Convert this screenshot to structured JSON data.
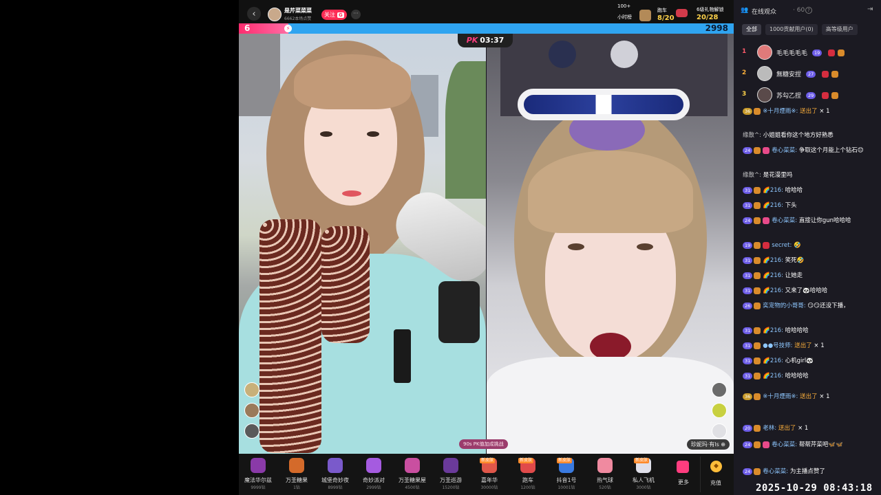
{
  "header": {
    "host_name": "是芹菜菜菜",
    "host_sub": "6662本场点赞",
    "follow_label": "关注",
    "follow_badge": "G",
    "stat1_top": "100+",
    "stat1_label": "小时榜",
    "stat2_label": "跑车",
    "stat2_value": "8/20",
    "stat3_label": "6级礼物解锁",
    "stat3_value": "20/28"
  },
  "pk": {
    "left_score": "6",
    "right_score": "2998",
    "timer_tag": "PK",
    "timer": "03:37",
    "challenge": "90s PK值加成挑战",
    "opponent": "珍妮玛·有ls"
  },
  "gifts": [
    {
      "name": "魔法华尔兹",
      "price": "9999钻",
      "color": "#8a3aa8"
    },
    {
      "name": "万圣糖果",
      "price": "1钻",
      "color": "#d46a2a"
    },
    {
      "name": "城堡奇妙夜",
      "price": "8999钻",
      "color": "#7a5acb"
    },
    {
      "name": "奇妙派对",
      "price": "2999钻",
      "color": "#a55be0"
    },
    {
      "name": "万圣糖果屋",
      "price": "4500钻",
      "color": "#c94fa0"
    },
    {
      "name": "万圣巡游",
      "price": "15200钻",
      "color": "#6a3a9a"
    },
    {
      "name": "嘉年华",
      "price": "30000钻",
      "color": "#e0574a",
      "tag": "新皮肤"
    },
    {
      "name": "跑车",
      "price": "1200钻",
      "color": "#e04a4a",
      "tag": "新皮肤"
    },
    {
      "name": "抖音1号",
      "price": "10001钻",
      "color": "#3a7ae0",
      "tag": "新皮肤"
    },
    {
      "name": "热气球",
      "price": "520钻",
      "color": "#f08aa0"
    },
    {
      "name": "私人飞机",
      "price": "3000钻",
      "color": "#e0e0ea",
      "tag": "新皮肤"
    }
  ],
  "gift_more": "更多",
  "recharge": "充值",
  "panel": {
    "title": "在线观众",
    "count": "· 60",
    "tabs": [
      "全部",
      "1000贡献用户(0)",
      "高等级用户"
    ],
    "ranks": [
      {
        "no": "1",
        "name": "毛毛毛毛毛",
        "level": "19",
        "color": "#e07a7a"
      },
      {
        "no": "2",
        "name": "無糖安捏",
        "level": "27",
        "color": "#bbbbbb"
      },
      {
        "no": "3",
        "name": "苏勾乙捏",
        "level": "29",
        "color": "#5a4a4a"
      }
    ]
  },
  "chat": [
    {
      "lvl": "36",
      "gold": true,
      "user": "※十月煙雨※:",
      "text": "送出了",
      "sent": true,
      "x": "× 1"
    },
    {
      "user": "缘散^:",
      "text": "小姐姐看你这个地方好熟悉"
    },
    {
      "lvl": "24",
      "fan": "pink",
      "user": "卷心菜菜:",
      "text": "争取这个月能上个钻石😊"
    },
    {
      "user": "缘散^:",
      "text": "是花漫里吗"
    },
    {
      "lvl": "31",
      "user": "🌈216:",
      "text": "哈哈哈"
    },
    {
      "lvl": "31",
      "user": "🌈216:",
      "text": "下头"
    },
    {
      "lvl": "24",
      "fan": "pink",
      "user": "卷心菜菜:",
      "text": "直接让你gun哈哈哈"
    },
    {
      "lvl": "19",
      "fan": "red",
      "user": "secret:",
      "text": "🤣"
    },
    {
      "lvl": "31",
      "user": "🌈216:",
      "text": "笑死🤣"
    },
    {
      "lvl": "31",
      "user": "🌈216:",
      "text": "让她走"
    },
    {
      "lvl": "31",
      "user": "🌈216:",
      "text": "又来了🐼哈哈哈"
    },
    {
      "lvl": "26",
      "user": "奕宠物的小哥哥:",
      "text": "😏😏还没下播，"
    },
    {
      "lvl": "31",
      "user": "🌈216:",
      "text": "哈哈哈哈"
    },
    {
      "lvl": "31",
      "user": "●●号技师:",
      "text": "送出了",
      "sent": true,
      "x": "× 1"
    },
    {
      "lvl": "31",
      "user": "🌈216:",
      "text": "心机girl🐼"
    },
    {
      "lvl": "31",
      "user": "🌈216:",
      "text": "哈哈哈哈"
    },
    {
      "lvl": "36",
      "gold": true,
      "user": "※十月煙雨※:",
      "text": "送出了",
      "sent": true,
      "x": "× 1"
    },
    {
      "lvl": "20",
      "user": "老林:",
      "text": "送出了",
      "sent": true,
      "x": "× 1"
    },
    {
      "lvl": "24",
      "fan": "pink",
      "user": "卷心菜菜:",
      "text": "帮帮芹菜吧🦋🦋"
    },
    {
      "lvl": "24",
      "user": "卷心菜菜:",
      "text": "为主播点赞了"
    }
  ],
  "timestamp": "2025-10-29 08:43:18"
}
